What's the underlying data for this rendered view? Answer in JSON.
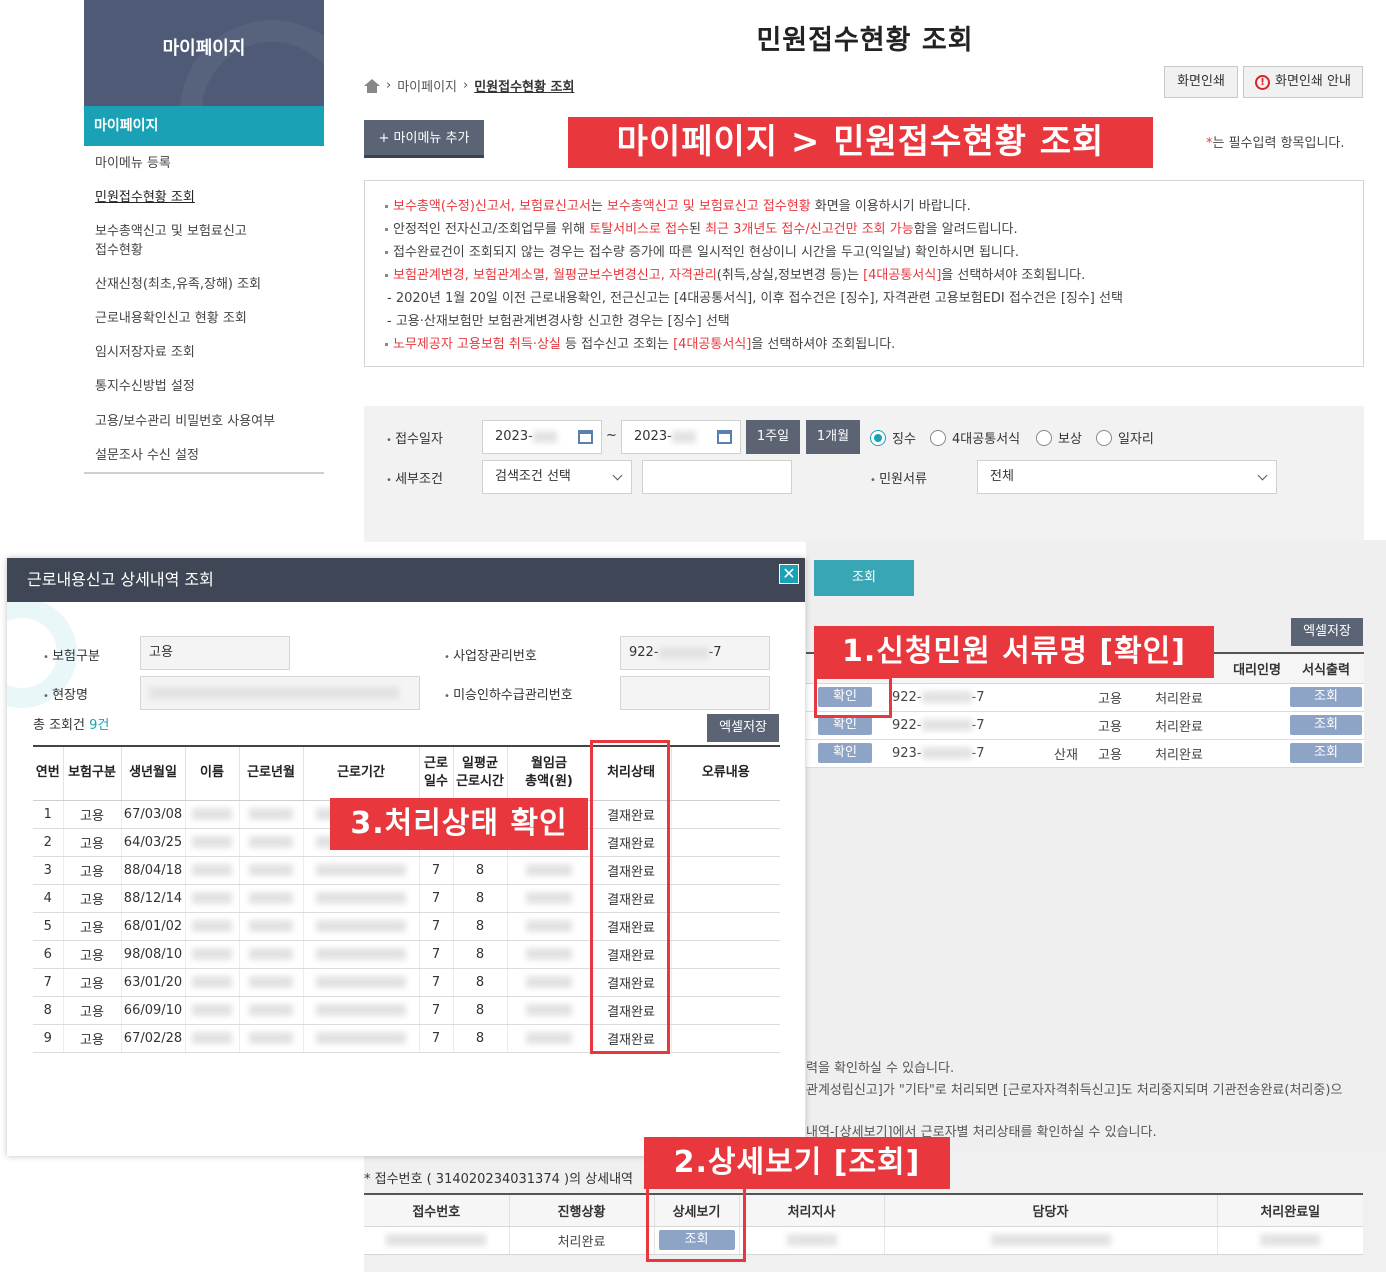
{
  "sidebar": {
    "title": "마이페이지",
    "selected": "마이페이지",
    "items": [
      "마이메뉴 등록",
      "민원접수현황 조회",
      "보수총액신고 및 보험료신고",
      "접수현황",
      "산재신청(최초,유족,장해) 조회",
      "근로내용확인신고 현황 조회",
      "임시저장자료 조회",
      "통지수신방법 설정",
      "고용/보수관리 비밀번호 사용여부",
      "설문조사 수신 설정"
    ]
  },
  "header": {
    "title": "민원접수현황 조회",
    "breadcrumb": [
      "마이페이지",
      "민원접수현황 조회"
    ],
    "print_label": "화면인쇄",
    "print_guide_label": "화면인쇄 안내",
    "mymenu_label": "+ 마이메뉴 추가",
    "banner": "마이페이지 > 민원접수현황 조회",
    "required_star": "*",
    "required_note": "는 필수입력 항목입니다."
  },
  "notice": {
    "l1a": "보수총액(수정)신고서, 보험료신고서",
    "l1b": "는 ",
    "l1c": "보수총액신고 및 보험료신고 접수현황",
    "l1d": " 화면을 이용하시기 바랍니다.",
    "l2a": "안정적인 전자신고/조회업무를 위해 ",
    "l2b": "토탈서비스로 접수",
    "l2c": "된 ",
    "l2d": "최근 3개년도 접수/신고건만 조회 가능",
    "l2e": "함을 알려드립니다.",
    "l3": "접수완료건이 조회되지 않는 경우는 접수량 증가에 따른 일시적인 현상이니 시간을 두고(익일날) 확인하시면 됩니다.",
    "l4a": "보험관계변경, 보험관계소멸, 월평균보수변경신고, 자격관리",
    "l4b": "(취득,상실,정보변경 등)는 ",
    "l4c": "[4대공통서식]",
    "l4d": "을 선택하셔야 조회됩니다.",
    "l5": "- 2020년 1월 20일 이전 근로내용확인, 전근신고는 [4대공통서식], 이후 접수건은 [징수], 자격관련 고용보험EDI 접수건은 [징수] 선택",
    "l6": "- 고용·산재보험만 보험관계변경사항 신고한 경우는 [징수] 선택",
    "l7a": "노무제공자 고용보험 취득·상실",
    "l7b": " 등 접수신고 조회는 ",
    "l7c": "[4대공통서식]",
    "l7d": "을 선택하셔야 조회됩니다."
  },
  "search": {
    "date_label": "접수일자",
    "date_from": "2023-",
    "date_sep": "~",
    "date_to": "2023-",
    "week_btn": "1주일",
    "month_btn": "1개월",
    "radios": [
      "징수",
      "4대공통서식",
      "보상",
      "일자리"
    ],
    "radio_selected": "징수",
    "detail_label": "세부조건",
    "detail_select": "검색조건 선택",
    "doc_label": "민원서류",
    "doc_select": "전체",
    "query_btn": "조회"
  },
  "results": {
    "excel_btn": "엑셀저장",
    "headers": [
      "대리인명",
      "서식출력"
    ],
    "rows": [
      {
        "btn": "확인",
        "no_a": "922-",
        "no_b": "-7",
        "type1": "",
        "type2": "고용",
        "status": "처리완료",
        "out": "조회"
      },
      {
        "btn": "확인",
        "no_a": "922-",
        "no_b": "-7",
        "type1": "",
        "type2": "고용",
        "status": "처리완료",
        "out": "조회"
      },
      {
        "btn": "확인",
        "no_a": "923-",
        "no_b": "-7",
        "type1": "산재",
        "type2": "고용",
        "status": "처리완료",
        "out": "조회"
      }
    ],
    "note1": "력을 확인하실 수 있습니다.",
    "note2": "관계성립신고]가 \"기타\"로 처리되면 [근로자자격취득신고]도 처리중지되며 기관전송완료(처리중)으",
    "note3": "내역-[상세보기]에서 근로자별 처리상태를 확인하실 수 있습니다."
  },
  "detail": {
    "caption": "* 접수번호 ( 314020234031374 )의 상세내역",
    "headers": [
      "접수번호",
      "진행상황",
      "상세보기",
      "처리지사",
      "담당자",
      "처리완료일"
    ],
    "status": "처리완료",
    "view_btn": "조회"
  },
  "modal": {
    "title": "근로내용신고 상세내역 조회",
    "close": "✕",
    "ins_label": "보험구분",
    "ins_value": "고용",
    "biz_label": "사업장관리번호",
    "biz_a": "922-",
    "biz_b": "-7",
    "site_label": "현장명",
    "sub_label": "미승인하수급관리번호",
    "total_label": "총 조회건 ",
    "total_count": "9건",
    "excel_btn": "엑셀저장",
    "headers": {
      "no": "연번",
      "ins": "보험구분",
      "birth": "생년월일",
      "name": "이름",
      "ym": "근로년월",
      "period": "근로기간",
      "days1": "근로",
      "days2": "일수",
      "hours1": "일평균",
      "hours2": "근로시간",
      "wage1": "월임금",
      "wage2": "총액(원)",
      "status": "처리상태",
      "error": "오류내용"
    },
    "rows": [
      {
        "no": "1",
        "ins": "고용",
        "birth": "67/03/08",
        "days": "",
        "hours": "",
        "status": "결재완료"
      },
      {
        "no": "2",
        "ins": "고용",
        "birth": "64/03/25",
        "days": "",
        "hours": "",
        "status": "결재완료"
      },
      {
        "no": "3",
        "ins": "고용",
        "birth": "88/04/18",
        "days": "7",
        "hours": "8",
        "status": "결재완료"
      },
      {
        "no": "4",
        "ins": "고용",
        "birth": "88/12/14",
        "days": "7",
        "hours": "8",
        "status": "결재완료"
      },
      {
        "no": "5",
        "ins": "고용",
        "birth": "68/01/02",
        "days": "7",
        "hours": "8",
        "status": "결재완료"
      },
      {
        "no": "6",
        "ins": "고용",
        "birth": "98/08/10",
        "days": "7",
        "hours": "8",
        "status": "결재완료"
      },
      {
        "no": "7",
        "ins": "고용",
        "birth": "63/01/20",
        "days": "7",
        "hours": "8",
        "status": "결재완료"
      },
      {
        "no": "8",
        "ins": "고용",
        "birth": "66/09/10",
        "days": "7",
        "hours": "8",
        "status": "결재완료"
      },
      {
        "no": "9",
        "ins": "고용",
        "birth": "67/02/28",
        "days": "7",
        "hours": "8",
        "status": "결재완료"
      }
    ]
  },
  "annotations": {
    "step1": "1.신청민원 서류명 [확인]",
    "step2": "2.상세보기 [조회]",
    "step3": "3.처리상태 확인"
  },
  "colors": {
    "accent": "#1ba1b5",
    "annotation_red": "#e8383d",
    "sidebar_header": "#4f5a77",
    "modal_header": "#3f4756"
  }
}
